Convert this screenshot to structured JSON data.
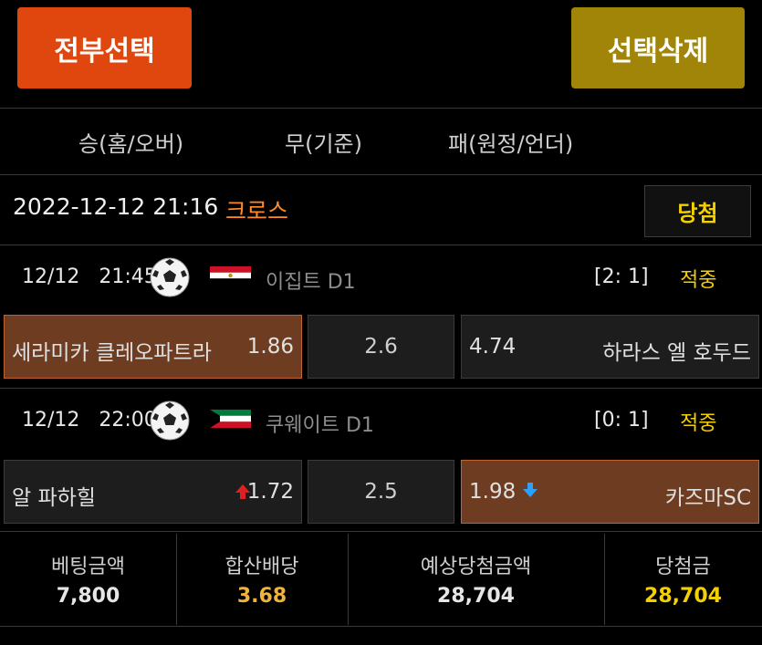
{
  "toolbar": {
    "select_all_label": "전부선택",
    "delete_selected_label": "선택삭제"
  },
  "columns": {
    "home": "승(홈/오버)",
    "draw": "무(기준)",
    "away": "패(원정/언더)"
  },
  "bet": {
    "datetime": "2022-12-12 21:16",
    "type": "크로스",
    "result": "당첨"
  },
  "matches": [
    {
      "date": "12/12",
      "time": "21:45",
      "league": "이집트 D1",
      "score": "[2: 1]",
      "status": "적중",
      "home_team": "세라미카 클레오파트라",
      "home_odd": "1.86",
      "draw_odd": "2.6",
      "away_odd": "4.74",
      "away_team": "하라스 엘 호두드"
    },
    {
      "date": "12/12",
      "time": "22:00",
      "league": "쿠웨이트 D1",
      "score": "[0: 1]",
      "status": "적중",
      "home_team": "알 파하힐",
      "home_odd": "1.72",
      "draw_odd": "2.5",
      "away_odd": "1.98",
      "away_team": "카즈마SC"
    }
  ],
  "summary": {
    "bet_amount_label": "베팅금액",
    "bet_amount": "7,800",
    "total_odds_label": "합산배당",
    "total_odds": "3.68",
    "expected_win_label": "예상당첨금액",
    "expected_win": "28,704",
    "win_amount_label": "당첨금",
    "win_amount": "28,704"
  },
  "colors": {
    "select_all_button": "#e0470e",
    "delete_button": "#a08508",
    "selected_cell": "#6e3c21",
    "accent_yellow": "#f5d000",
    "bet_type": "#ff8a2a",
    "odds_up": "#e02020",
    "odds_down": "#2aa0ff"
  },
  "icons": {
    "sport": "soccer-ball-icon",
    "odds_up": "arrow-up-icon",
    "odds_down": "arrow-down-icon"
  }
}
